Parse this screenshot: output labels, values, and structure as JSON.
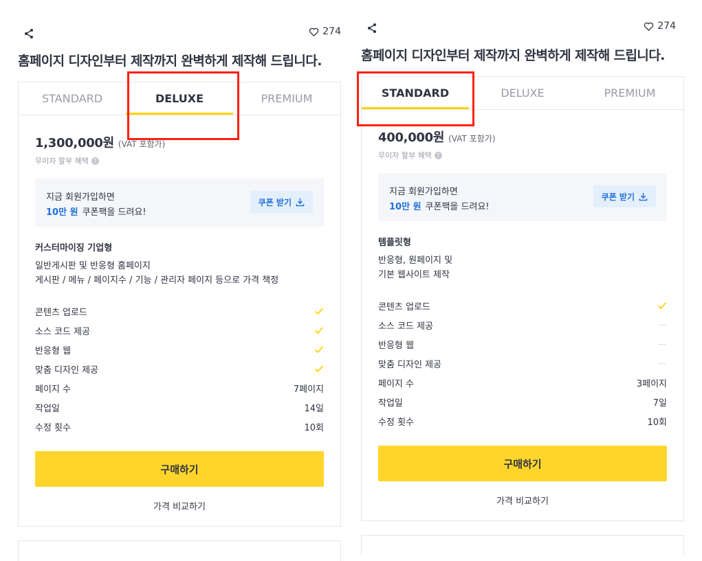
{
  "likes_count": "274",
  "title": "홈페이지 디자인부터 제작까지 완벽하게 제작해 드립니다.",
  "tabs": [
    "STANDARD",
    "DELUXE",
    "PREMIUM"
  ],
  "installment": "무이자 할부 혜택",
  "vat": "(VAT 포함가)",
  "coupon": {
    "line1": "지금 회원가입하면",
    "amount": "10만 원",
    "line2_rest": "쿠폰팩을 드려요!",
    "button": "쿠폰 받기"
  },
  "features_labels": [
    "콘텐츠 업로드",
    "소스 코드 제공",
    "반응형 웹",
    "맞춤 디자인 제공",
    "페이지 수",
    "작업일",
    "수정 횟수"
  ],
  "buy_label": "구매하기",
  "compare_label": "가격 비교하기",
  "left": {
    "active_tab": "DELUXE",
    "price": "1,300,000원",
    "package_name": "커스터마이징 기업형",
    "description_lines": [
      "일반게시판 및 반응형 홈페이지",
      "게시판 / 메뉴 / 페이지수 / 기능 / 관리자 페이지 등으로 가격 책정"
    ],
    "included": [
      true,
      true,
      true,
      true
    ],
    "pages": "7페이지",
    "work_days": "14일",
    "revisions": "10회"
  },
  "right": {
    "active_tab": "STANDARD",
    "price": "400,000원",
    "package_name": "템플릿형",
    "description_lines": [
      "반응형, 원페이지 및",
      "기본 웹사이트 제작"
    ],
    "included": [
      true,
      false,
      false,
      false
    ],
    "pages": "3페이지",
    "work_days": "7일",
    "revisions": "10회"
  },
  "colors": {
    "accent_yellow": "#ffd52b",
    "highlight_red": "#ff1f0f",
    "coupon_blue": "#1e6fd9"
  }
}
